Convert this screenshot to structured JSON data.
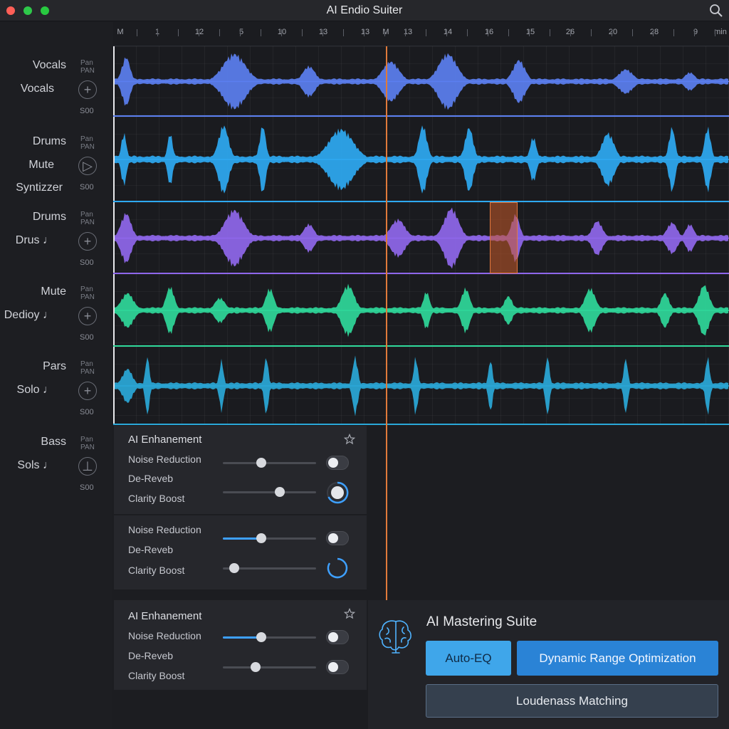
{
  "window": {
    "title": "AI Endio Suiter"
  },
  "ruler": {
    "labels": [
      "M",
      "1",
      "12",
      "5",
      "10",
      "13",
      "13",
      "M",
      "13",
      "14",
      "16",
      "15",
      "26",
      "20",
      "28",
      "9",
      "min"
    ]
  },
  "tracks": [
    {
      "name1": "Vocals",
      "name2": "Vocals",
      "name3": "",
      "pan": "Pan\nPAN",
      "ctrl": "+",
      "solo": "S00",
      "color": "#5b7ff0"
    },
    {
      "name1": "Drums",
      "name2": "Mute",
      "name3": "Syntizzer",
      "pan": "Pan\nPAN",
      "ctrl": "▷",
      "solo": "S00",
      "color": "#2ea9f2"
    },
    {
      "name1": "Drums",
      "name2": "Drus ♩",
      "name3": "",
      "pan": "Pan\nPAN",
      "ctrl": "+",
      "solo": "S00",
      "color": "#8f67ec"
    },
    {
      "name1": "Mute",
      "name2": "Dedioy ♩",
      "name3": "",
      "pan": "Pan\nPAN",
      "ctrl": "+",
      "solo": "S00",
      "color": "#2fd89a"
    },
    {
      "name1": "Pars",
      "name2": "Solo ♩",
      "name3": "",
      "pan": "Pan\nPAN",
      "ctrl": "+",
      "solo": "S00",
      "color": "#2aa8d8"
    },
    {
      "name1": "Bass",
      "name2": "Sols ♩",
      "name3": "",
      "pan": "Pan\nPAN",
      "ctrl": "⊥",
      "solo": "S00",
      "color": "#4a8cd6"
    }
  ],
  "enhance_panel_1": {
    "title": "AI Enhanement",
    "rows": [
      {
        "label": "Noise Reduction",
        "value": 0.41,
        "control": "toggle"
      },
      {
        "label": "De-Reveb"
      },
      {
        "label": "Clarity Boost",
        "value": 0.61,
        "control": "dial"
      }
    ]
  },
  "enhance_panel_2": {
    "rows": [
      {
        "label": "Noise Reduction",
        "value": 0.41,
        "control": "toggle"
      },
      {
        "label": "De-Reveb"
      },
      {
        "label": "Clarity Boost",
        "value": 0.12,
        "control": "dial"
      }
    ]
  },
  "enhance_panel_3": {
    "title": "AI Enhanement",
    "rows": [
      {
        "label": "Noise Reduction",
        "value": 0.41,
        "control": "toggle"
      },
      {
        "label": "De-Reveb"
      },
      {
        "label": "Clarity Boost",
        "value": 0.35,
        "control": "toggle"
      }
    ]
  },
  "mastering": {
    "title": "AI Mastering Suite",
    "auto_eq": "Auto-EQ",
    "dro": "Dynamic Range Optimization",
    "loudness": "Loudenass Matching"
  },
  "icons": {
    "search": "search-icon",
    "star": "star-icon",
    "brain": "brain-icon"
  }
}
